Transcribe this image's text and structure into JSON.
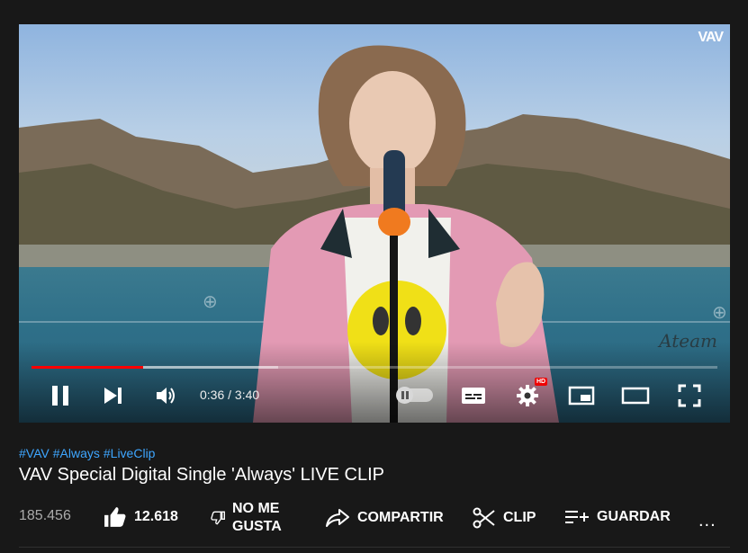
{
  "player": {
    "channel_watermark": "VAV",
    "corner_watermark": "Ateam",
    "time_current": "0:36",
    "time_total": "3:40",
    "time_display": "0:36 / 3:40",
    "progress_played_fraction": 0.163,
    "progress_buffered_fraction": 0.36,
    "autoplay_on": false,
    "quality_badge": "HD",
    "controls": [
      {
        "name": "pause-button",
        "icon": "pause-icon"
      },
      {
        "name": "next-button",
        "icon": "skip-next-icon"
      },
      {
        "name": "volume-button",
        "icon": "volume-icon"
      },
      {
        "name": "autoplay-toggle",
        "icon": "autoplay-toggle-icon"
      },
      {
        "name": "subtitles-button",
        "icon": "subtitles-icon"
      },
      {
        "name": "settings-button",
        "icon": "gear-icon"
      },
      {
        "name": "miniplayer-button",
        "icon": "miniplayer-icon"
      },
      {
        "name": "theater-button",
        "icon": "theater-mode-icon"
      },
      {
        "name": "fullscreen-button",
        "icon": "fullscreen-icon"
      }
    ],
    "colors": {
      "progress": "#ff0000",
      "badge": "#e00000"
    }
  },
  "video": {
    "hashtags": [
      "#VAV",
      "#Always",
      "#LiveClip"
    ],
    "title": "VAV Special Digital Single 'Always' LIVE CLIP",
    "views": "185.456"
  },
  "actions": {
    "like_count": "12.618",
    "dislike_label_line1": "NO ME",
    "dislike_label_line2": "GUSTA",
    "share_label": "COMPARTIR",
    "clip_label": "CLIP",
    "save_label": "GUARDAR",
    "more_label": "..."
  },
  "colors": {
    "background": "#181818",
    "hashtag": "#3ea6ff",
    "secondary_text": "#aaaaaa"
  }
}
